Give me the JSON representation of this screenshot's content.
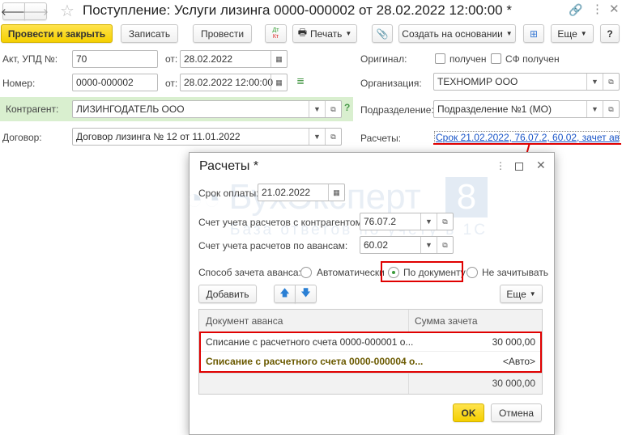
{
  "window": {
    "title": "Поступление: Услуги лизинга 0000-000002 от 28.02.2022 12:00:00 *"
  },
  "toolbar": {
    "post_close": "Провести и закрыть",
    "save": "Записать",
    "post": "Провести",
    "dtkt_top": "Дт",
    "dtkt_bottom": "Кт",
    "print": "Печать",
    "create_based": "Создать на основании",
    "more": "Еще",
    "help": "?"
  },
  "form": {
    "act_label": "Акт, УПД №:",
    "act_value": "70",
    "from_label": "от:",
    "act_date": "28.02.2022",
    "number_label": "Номер:",
    "number_value": "0000-000002",
    "number_date": "28.02.2022 12:00:00",
    "counterparty_label": "Контрагент:",
    "counterparty_value": "ЛИЗИНГОДАТЕЛЬ ООО",
    "contract_label": "Договор:",
    "contract_value": "Договор лизинга № 12 от 11.01.2022",
    "original_label": "Оригинал:",
    "received": "получен",
    "sf_received": "СФ получен",
    "org_label": "Организация:",
    "org_value": "ТЕХНОМИР ООО",
    "dept_label": "Подразделение:",
    "dept_value": "Подразделение №1 (МО)",
    "settlements_label": "Расчеты:",
    "settlements_link": "Срок 21.02.2022, 76.07.2, 60.02, зачет ав..."
  },
  "watermark": {
    "brand": "БухЭксперт",
    "digit": "8",
    "tagline": "База ответов по учёту в 1С"
  },
  "dialog": {
    "title": "Расчеты *",
    "due_label": "Срок оплаты:",
    "due_value": "21.02.2022",
    "acc_cp_label": "Счет учета расчетов с контрагентом:",
    "acc_cp_value": "76.07.2",
    "acc_adv_label": "Счет учета расчетов по авансам:",
    "acc_adv_value": "60.02",
    "offset_label": "Способ зачета аванса:",
    "radio_options": [
      {
        "label": "Автоматически",
        "selected": false
      },
      {
        "label": "По документу",
        "selected": true
      },
      {
        "label": "Не зачитывать",
        "selected": false
      }
    ],
    "add": "Добавить",
    "more": "Еще",
    "table": {
      "columns": [
        "Документ аванса",
        "Сумма зачета"
      ],
      "rows": [
        {
          "doc": "Списание с расчетного счета 0000-000001 о...",
          "sum": "30 000,00"
        },
        {
          "doc": "Списание с расчетного счета 0000-000004 о...",
          "sum": "<Авто>"
        }
      ],
      "total": "30 000,00"
    },
    "ok": "OK",
    "cancel": "Отмена"
  },
  "colors": {
    "accent_yellow": "#f5d000",
    "link": "#1a55c8",
    "highlight_red": "#e00000",
    "counterparty_bg": "#d9efcf",
    "active_row_text": "#6b5a00"
  }
}
